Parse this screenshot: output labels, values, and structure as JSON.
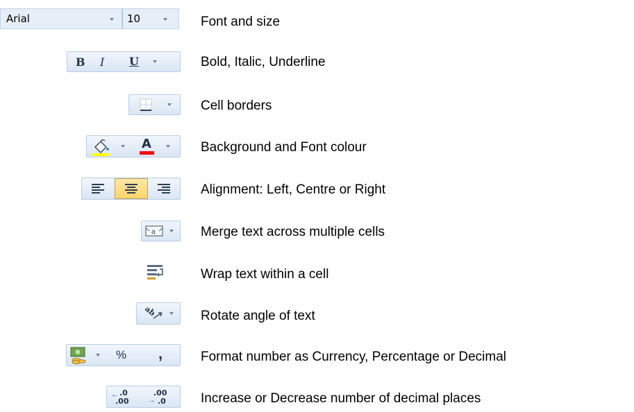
{
  "font_controls": {
    "font_name": "Arial",
    "font_size": "10",
    "description": "Font and size"
  },
  "style_controls": {
    "bold_label": "B",
    "italic_label": "I",
    "underline_label": "U",
    "description": "Bold, Italic, Underline"
  },
  "border_controls": {
    "description": "Cell borders"
  },
  "colour_controls": {
    "font_colour_label": "A",
    "fill_colour": "#ffff00",
    "font_colour": "#ff0000",
    "description": "Background and Font colour"
  },
  "alignment_controls": {
    "description": "Alignment: Left, Centre or Right",
    "selected": "Centre"
  },
  "merge_controls": {
    "icon_text": "a",
    "description": "Merge text across multiple cells"
  },
  "wrap_controls": {
    "description": "Wrap text within a cell"
  },
  "rotate_controls": {
    "icon_text": "ab",
    "description": "Rotate angle of text"
  },
  "number_controls": {
    "percent_label": "%",
    "comma_label": ",",
    "description": "Format number as Currency, Percentage or Decimal"
  },
  "decimal_controls": {
    "increase_label": ".00",
    "decrease_label": ".00",
    "increase_sub": ".0",
    "decrease_sub": ".0",
    "description": "Increase or Decrease number of decimal places"
  },
  "colors": {
    "accent": "#b9cde5",
    "selected_bg": "#ffd36b"
  }
}
